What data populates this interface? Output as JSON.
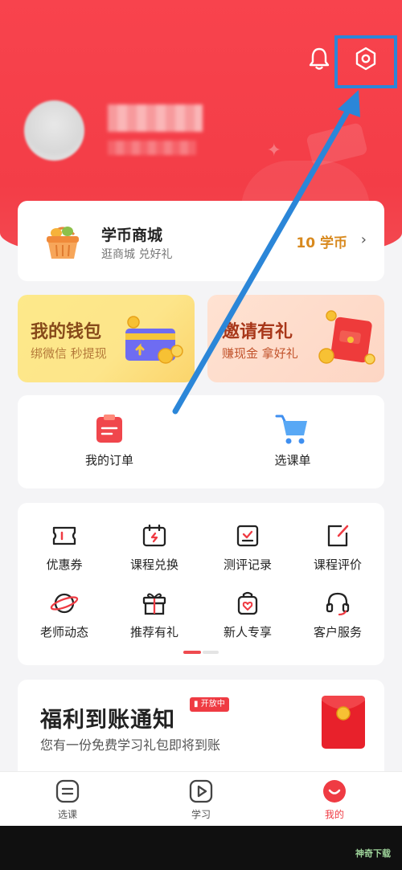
{
  "profile": {
    "username": "",
    "subtitle": ""
  },
  "top_actions": {
    "bell_icon": "bell-icon",
    "settings_icon": "settings-icon"
  },
  "mall": {
    "title": "学币商城",
    "subtitle": "逛商城 兑好礼",
    "coins": "10 学币",
    "chevron": "›"
  },
  "wallet": {
    "title": "我的钱包",
    "subtitle": "绑微信 秒提现"
  },
  "invite": {
    "title": "邀请有礼",
    "subtitle": "赚现金 拿好礼"
  },
  "orders": [
    {
      "label": "我的订单",
      "icon": "order-clipboard-icon"
    },
    {
      "label": "选课单",
      "icon": "cart-icon"
    }
  ],
  "grid": [
    {
      "label": "优惠券",
      "icon": "coupon-icon"
    },
    {
      "label": "课程兑换",
      "icon": "exchange-calendar-icon"
    },
    {
      "label": "测评记录",
      "icon": "assessment-icon"
    },
    {
      "label": "课程评价",
      "icon": "edit-review-icon"
    },
    {
      "label": "老师动态",
      "icon": "planet-icon"
    },
    {
      "label": "推荐有礼",
      "icon": "gift-icon"
    },
    {
      "label": "新人专享",
      "icon": "heart-bag-icon"
    },
    {
      "label": "客户服务",
      "icon": "headset-icon"
    }
  ],
  "promo": {
    "title": "福利到账通知",
    "badge": "开放中",
    "subtitle": "您有一份免费学习礼包即将到账"
  },
  "tabs": [
    {
      "label": "选课",
      "icon": "course-icon",
      "active": false
    },
    {
      "label": "学习",
      "icon": "play-icon",
      "active": false
    },
    {
      "label": "我的",
      "icon": "me-icon",
      "active": true
    }
  ],
  "watermark": "神奇下载",
  "colors": {
    "header_red": "#f33d47",
    "accent_red": "#ef3b43",
    "annotation_blue": "#2b86d8",
    "coin_gold": "#d8891e"
  }
}
